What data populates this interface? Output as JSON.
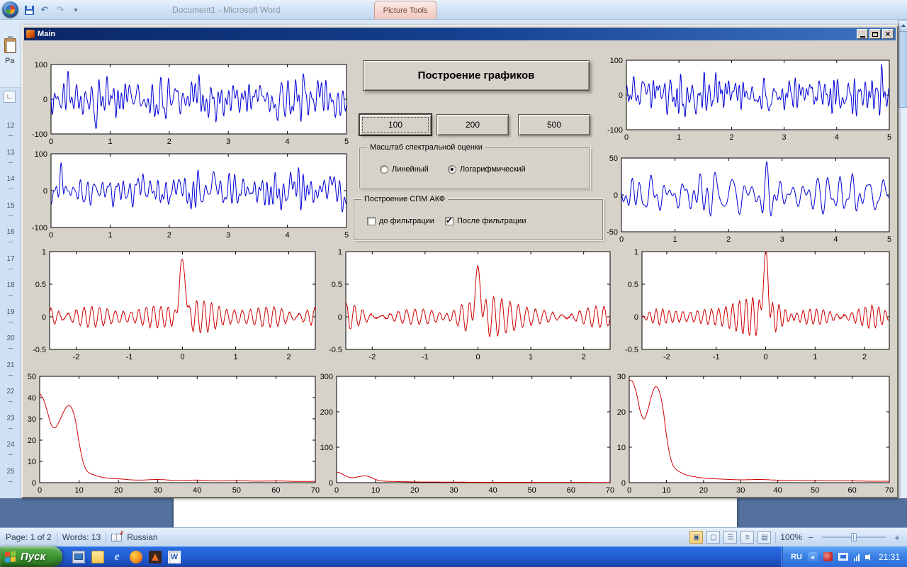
{
  "word": {
    "title": "Document1 - Microsoft Word",
    "context_tab": "Picture Tools",
    "ribbon_fragment": {
      "paste_label": "Pa"
    },
    "ruler": {
      "numbers": [
        "12",
        "13",
        "14",
        "15",
        "16",
        "17",
        "18",
        "19",
        "20",
        "21",
        "22",
        "23",
        "24",
        "25"
      ]
    },
    "status_bar": {
      "page": "Page: 1 of 2",
      "words": "Words: 13",
      "language": "Russian",
      "zoom": "100%"
    }
  },
  "matlab": {
    "title": "Main",
    "build_button": "Построение графиков",
    "length_buttons": [
      "100",
      "200",
      "500"
    ],
    "scale_panel": {
      "title": "Масштаб спектральной оценки",
      "radio_linear": "Линейный",
      "radio_log": "Логарифмический",
      "linear_selected": false,
      "log_selected": true
    },
    "spm_panel": {
      "title": "Построение СПМ АКФ",
      "checkbox_before": "до фильтрации",
      "checkbox_after": "После фильтрации",
      "before_checked": false,
      "after_checked": true
    }
  },
  "taskbar": {
    "start_label": "Пуск",
    "language_indicator": "RU",
    "clock": "21:31"
  },
  "chart_data": [
    {
      "dom": "plot-sig1",
      "name": "signal-top-left",
      "type": "line",
      "color": "#0000d8",
      "xlim": [
        0,
        5
      ],
      "ylim": [
        -100,
        100
      ],
      "xticks": [
        0,
        1,
        2,
        3,
        4,
        5
      ],
      "yticks": [
        -100,
        0,
        100
      ],
      "grid": false,
      "box": true,
      "signal": {
        "kind": "noise",
        "seed": 11,
        "n": 560,
        "amp": 27,
        "fmin": 0.5,
        "fmax": 18,
        "ncomp": 30
      },
      "description": "broadband noisy signal, amplitude about ±80 of ±100 range"
    },
    {
      "dom": "plot-sig2",
      "name": "signal-mid-left",
      "type": "line",
      "color": "#0000d8",
      "xlim": [
        0,
        5
      ],
      "ylim": [
        -100,
        100
      ],
      "xticks": [
        0,
        1,
        2,
        3,
        4,
        5
      ],
      "yticks": [
        -100,
        0,
        100
      ],
      "grid": false,
      "box": true,
      "signal": {
        "kind": "noise",
        "seed": 23,
        "n": 560,
        "amp": 25,
        "fmin": 0.5,
        "fmax": 16,
        "ncomp": 28
      },
      "description": "noisy signal, amplitude about ±70 of ±100 range"
    },
    {
      "dom": "plot-sig3",
      "name": "signal-top-right",
      "type": "line",
      "color": "#0000d8",
      "xlim": [
        0,
        5
      ],
      "ylim": [
        -100,
        100
      ],
      "xticks": [
        0,
        1,
        2,
        3,
        4,
        5
      ],
      "yticks": [
        -100,
        0,
        100
      ],
      "grid": false,
      "box": true,
      "signal": {
        "kind": "noise",
        "seed": 37,
        "n": 560,
        "amp": 27,
        "fmin": 0.5,
        "fmax": 18,
        "ncomp": 30
      },
      "description": "broadband noisy signal, amplitude about ±80 of ±100 range"
    },
    {
      "dom": "plot-sig4",
      "name": "signal-mid-right",
      "type": "line",
      "color": "#0000d8",
      "xlim": [
        0,
        5
      ],
      "ylim": [
        -50,
        50
      ],
      "xticks": [
        0,
        1,
        2,
        3,
        4,
        5
      ],
      "yticks": [
        -50,
        0,
        50
      ],
      "grid": false,
      "box": true,
      "signal": {
        "kind": "noise",
        "seed": 49,
        "n": 560,
        "amp": 15,
        "fmin": 2,
        "fmax": 9,
        "ncomp": 20
      },
      "description": "filtered narrowband signal filling ±45 of ±50 range"
    },
    {
      "dom": "plot-acf1",
      "name": "acf-left",
      "type": "line",
      "color": "#d00000",
      "xlim": [
        -2.5,
        2.5
      ],
      "ylim": [
        -0.5,
        1
      ],
      "xticks": [
        -2,
        -1,
        0,
        1,
        2
      ],
      "yticks": [
        -0.5,
        0,
        0.5,
        1
      ],
      "grid": false,
      "box": true,
      "signal": {
        "kind": "acf",
        "seed": 5,
        "peak": 1,
        "freq": 7.2,
        "ripple": 0.13,
        "n": 700
      },
      "description": "autocorrelation: unit spike at lag 0, oscillating sidelobes about ±0.2"
    },
    {
      "dom": "plot-acf2",
      "name": "acf-middle",
      "type": "line",
      "color": "#d00000",
      "xlim": [
        -2.5,
        2.5
      ],
      "ylim": [
        -0.5,
        1
      ],
      "xticks": [
        -2,
        -1,
        0,
        1,
        2
      ],
      "yticks": [
        -0.5,
        0,
        0.5,
        1
      ],
      "grid": false,
      "box": true,
      "signal": {
        "kind": "acf",
        "seed": 6,
        "peak": 0.78,
        "freq": 6.6,
        "ripple": 0.11,
        "n": 700
      },
      "description": "autocorrelation: peak about 0.78 at lag 0, sidelobes about ±0.18"
    },
    {
      "dom": "plot-acf3",
      "name": "acf-right",
      "type": "line",
      "color": "#d00000",
      "xlim": [
        -2.5,
        2.5
      ],
      "ylim": [
        -0.5,
        1
      ],
      "xticks": [
        -2,
        -1,
        0,
        1,
        2
      ],
      "yticks": [
        -0.5,
        0,
        0.5,
        1
      ],
      "grid": false,
      "box": true,
      "signal": {
        "kind": "acf",
        "seed": 7,
        "peak": 1,
        "freq": 7.6,
        "ripple": 0.12,
        "n": 700
      },
      "description": "autocorrelation: unit spike at lag 0, oscillating sidelobes about ±0.2"
    },
    {
      "dom": "plot-psd1",
      "name": "psd-left",
      "type": "line",
      "color": "#d00000",
      "xlim": [
        0,
        70
      ],
      "ylim": [
        0,
        50
      ],
      "xticks": [
        0,
        10,
        20,
        30,
        40,
        50,
        60,
        70
      ],
      "yticks": [
        0,
        10,
        20,
        30,
        40,
        50
      ],
      "grid": false,
      "box": true,
      "signal": {
        "kind": "curve",
        "x": [
          0,
          1,
          2,
          3,
          4,
          5,
          6,
          7,
          8,
          9,
          10,
          11,
          12,
          14,
          16,
          18,
          20,
          25,
          30,
          35,
          40,
          45,
          50,
          55,
          60,
          65,
          70
        ],
        "y": [
          42,
          39,
          33,
          27,
          26,
          29,
          33,
          36,
          35.5,
          30,
          19,
          10,
          5.5,
          3.5,
          2.5,
          2,
          1.8,
          1.2,
          1.5,
          1,
          1.2,
          0.8,
          1,
          0.7,
          0.8,
          0.6,
          0.6
        ]
      },
      "description": "PSD: 42 at 0, local peak 36 near 7, near zero above 15"
    },
    {
      "dom": "plot-psd2",
      "name": "psd-middle",
      "type": "line",
      "color": "#d00000",
      "xlim": [
        0,
        70
      ],
      "ylim": [
        0,
        300
      ],
      "xticks": [
        0,
        10,
        20,
        30,
        40,
        50,
        60,
        70
      ],
      "yticks": [
        0,
        100,
        200,
        300
      ],
      "grid": false,
      "box": true,
      "signal": {
        "kind": "curve",
        "x": [
          0,
          1,
          2,
          3,
          4,
          5,
          6,
          7,
          8,
          9,
          10,
          11,
          12,
          14,
          16,
          18,
          20,
          25,
          30,
          35,
          40,
          45,
          50,
          55,
          60,
          65,
          70
        ],
        "y": [
          30,
          27,
          21,
          16,
          14,
          15.5,
          17.5,
          19,
          18,
          14,
          9,
          6,
          4.5,
          3.5,
          3,
          2.5,
          2,
          1.8,
          1.5,
          1.2,
          1,
          1,
          0.9,
          0.8,
          0.8,
          0.7,
          0.7
        ]
      },
      "description": "PSD on 0-300 scale: small bump 30 at 0 and 19 near 7, flat near zero after 15"
    },
    {
      "dom": "plot-psd3",
      "name": "psd-right",
      "type": "line",
      "color": "#d00000",
      "xlim": [
        0,
        70
      ],
      "ylim": [
        0,
        30
      ],
      "xticks": [
        0,
        10,
        20,
        30,
        40,
        50,
        60,
        70
      ],
      "yticks": [
        0,
        10,
        20,
        30
      ],
      "grid": false,
      "box": true,
      "signal": {
        "kind": "curve",
        "x": [
          0,
          1,
          2,
          3,
          4,
          5,
          6,
          7,
          8,
          9,
          10,
          11,
          12,
          14,
          16,
          18,
          20,
          25,
          30,
          35,
          40,
          45,
          50,
          55,
          60,
          65,
          70
        ],
        "y": [
          29,
          28.3,
          25,
          20,
          18,
          20.5,
          24.5,
          27,
          26,
          21.5,
          13.5,
          7.5,
          4.5,
          2.8,
          2,
          1.6,
          1.3,
          1,
          0.8,
          0.9,
          0.7,
          0.6,
          0.6,
          0.5,
          0.5,
          0.4,
          0.4
        ]
      },
      "description": "PSD: 29 at 0, local peak 27 near 7, near zero above 15"
    }
  ]
}
